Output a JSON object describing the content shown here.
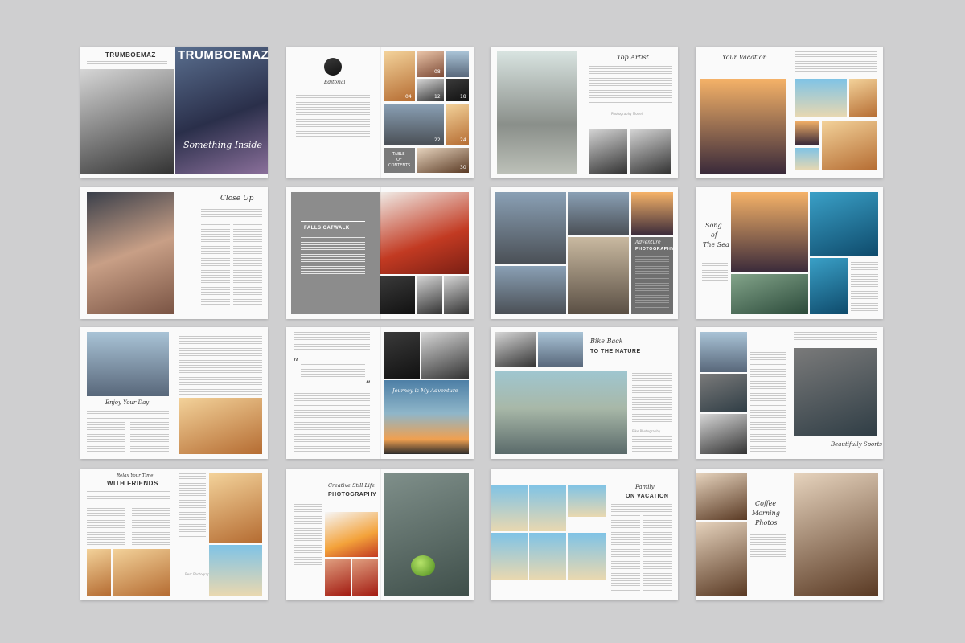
{
  "spreads": {
    "cover": {
      "title_left": "TRUMBOEMAZ",
      "title_right": "TRUMBOEMAZ",
      "cover_text": "Something Inside"
    },
    "editorial": {
      "title": "Editorial",
      "toc_line1": "TABLE",
      "toc_line2": "OF",
      "toc_line3": "CONTENTS",
      "n1": "08",
      "n2": "12",
      "n3": "18",
      "n4": "22",
      "n5": "24",
      "n6": "30",
      "n7": "04"
    },
    "top_artist": {
      "title": "Top Artist",
      "caption": "Photography Model"
    },
    "vacation": {
      "title": "Your Vacation"
    },
    "close_up": {
      "title": "Close Up"
    },
    "catwalk": {
      "title": "FALLS CATWALK"
    },
    "adventure": {
      "title_line1": "Adventure",
      "title_line2": "PHOTOGRAPHY"
    },
    "sea": {
      "line1": "Song",
      "line2": "of",
      "line3": "The Sea"
    },
    "enjoy": {
      "title": "Enjoy Your Day"
    },
    "journey": {
      "title": "Journey is My Adventure",
      "quote_open": "“",
      "quote_close": "”"
    },
    "bike": {
      "line1": "Bike Back",
      "line2": "TO THE NATURE",
      "caption": "Bike Photography"
    },
    "sports": {
      "title": "Beautifully Sports"
    },
    "friends": {
      "line1": "Relax Your Time",
      "line2": "WITH FRIENDS",
      "caption": "Best Photography"
    },
    "still_life": {
      "line1": "Creative Still Life",
      "line2": "PHOTOGRAPHY"
    },
    "family": {
      "line1": "Family",
      "line2": "ON VACATION"
    },
    "coffee": {
      "line1": "Coffee",
      "line2": "Morning",
      "line3": "Photos"
    }
  }
}
